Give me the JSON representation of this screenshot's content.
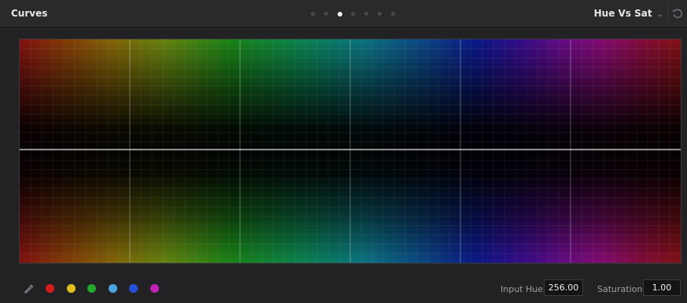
{
  "header": {
    "title": "Curves",
    "page_count": 7,
    "active_page": 3,
    "mode_label": "Hue Vs Sat",
    "reset_icon": "reset-icon"
  },
  "graph": {
    "curve": "flat"
  },
  "footer": {
    "picker_icon": "eyedropper-icon",
    "swatches": [
      {
        "name": "red",
        "color": "#d81c1c"
      },
      {
        "name": "yellow",
        "color": "#e2c21a"
      },
      {
        "name": "green",
        "color": "#22a82a"
      },
      {
        "name": "cyan",
        "color": "#4aa6e6"
      },
      {
        "name": "blue",
        "color": "#2450e0"
      },
      {
        "name": "magenta",
        "color": "#c422b6"
      }
    ],
    "input_hue_label": "Input Hue",
    "input_hue_value": "256.00",
    "saturation_label": "Saturation",
    "saturation_value": "1.00"
  },
  "colors": {
    "panel_bg": "#222224",
    "header_bg": "#2a2a2c",
    "curve_line": "#e8e8e8"
  }
}
